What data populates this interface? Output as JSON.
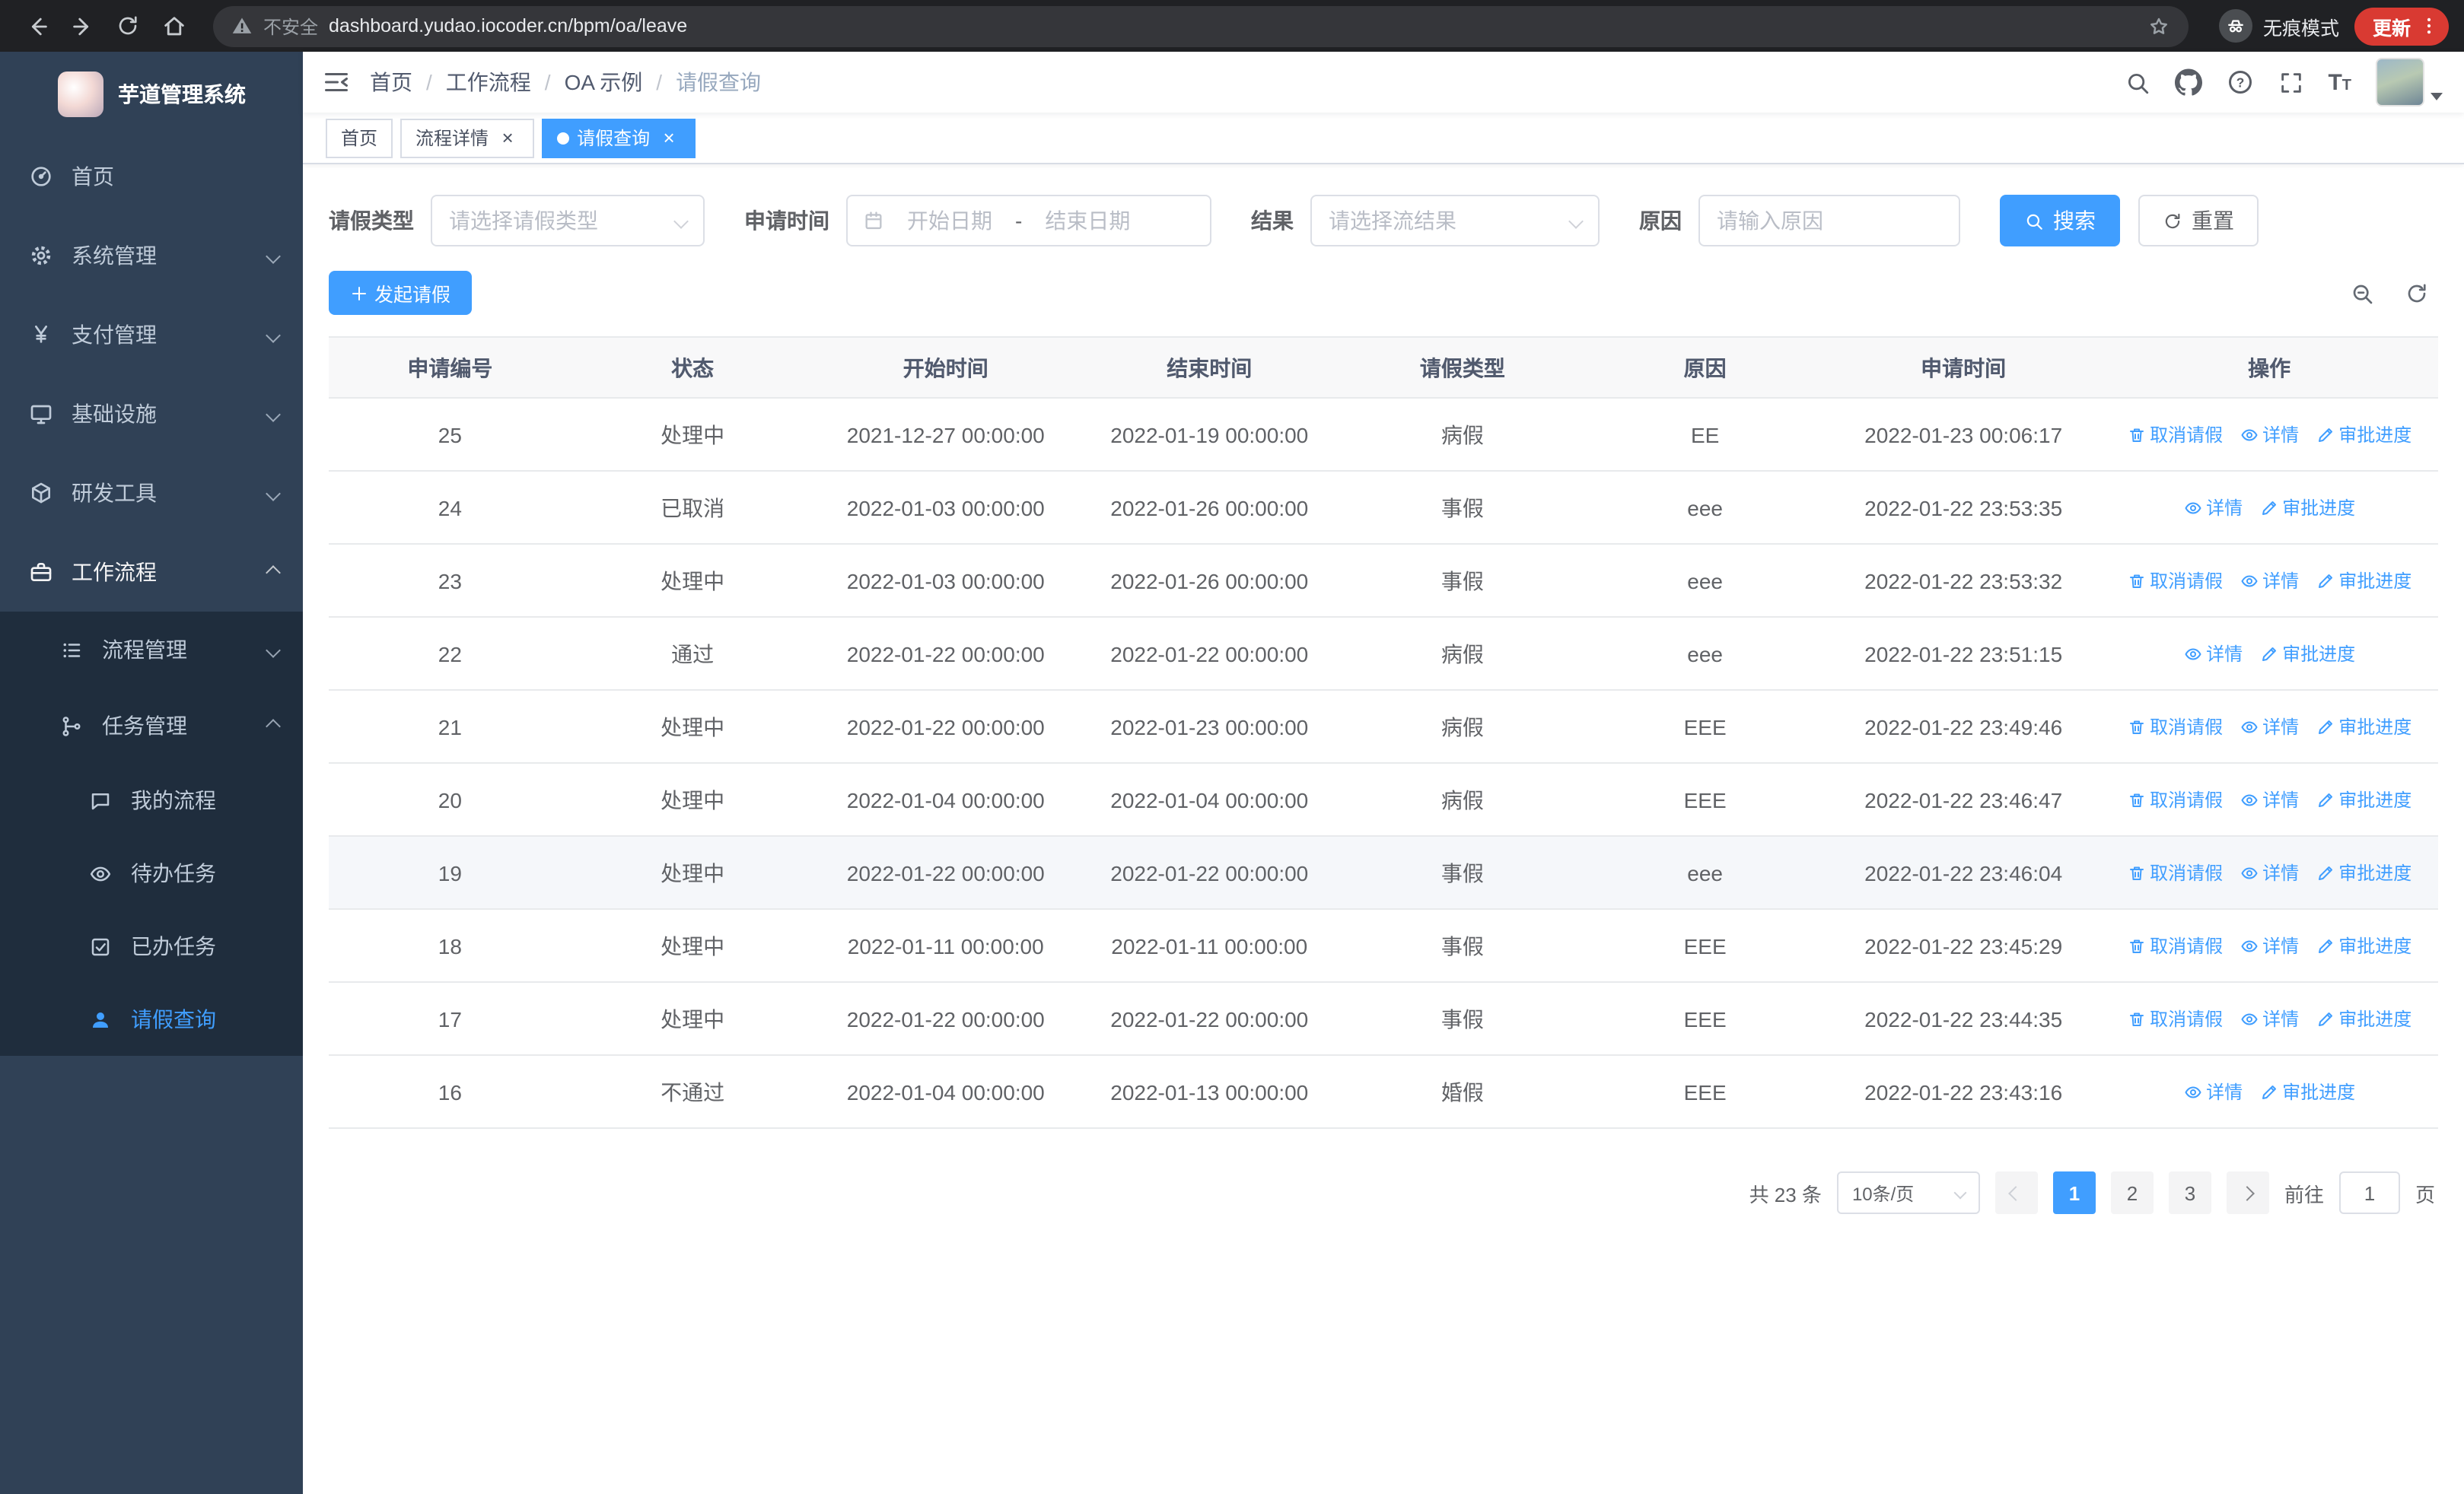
{
  "browser": {
    "security_label": "不安全",
    "url": "dashboard.yudao.iocoder.cn/bpm/oa/leave",
    "incognito_label": "无痕模式",
    "update_button": "更新"
  },
  "sidebar": {
    "app_title": "芋道管理系统",
    "items": [
      {
        "label": "首页"
      },
      {
        "label": "系统管理"
      },
      {
        "label": "支付管理"
      },
      {
        "label": "基础设施"
      },
      {
        "label": "研发工具"
      },
      {
        "label": "工作流程"
      }
    ],
    "sub_items": [
      {
        "label": "流程管理"
      },
      {
        "label": "任务管理"
      }
    ],
    "task_items": [
      {
        "label": "我的流程"
      },
      {
        "label": "待办任务"
      },
      {
        "label": "已办任务"
      },
      {
        "label": "请假查询"
      }
    ]
  },
  "header": {
    "breadcrumb": [
      "首页",
      "工作流程",
      "OA 示例",
      "请假查询"
    ]
  },
  "tabs": [
    {
      "label": "首页",
      "closable": false,
      "active": false
    },
    {
      "label": "流程详情",
      "closable": true,
      "active": false
    },
    {
      "label": "请假查询",
      "closable": true,
      "active": true
    }
  ],
  "filters": {
    "leave_type_label": "请假类型",
    "leave_type_placeholder": "请选择请假类型",
    "apply_time_label": "申请时间",
    "start_date_placeholder": "开始日期",
    "range_separator": "-",
    "end_date_placeholder": "结束日期",
    "result_label": "结果",
    "result_placeholder": "请选择流结果",
    "reason_label": "原因",
    "reason_placeholder": "请输入原因",
    "search_button": "搜索",
    "reset_button": "重置"
  },
  "toolbar": {
    "create_button": "发起请假"
  },
  "table": {
    "columns": [
      "申请编号",
      "状态",
      "开始时间",
      "结束时间",
      "请假类型",
      "原因",
      "申请时间",
      "操作"
    ],
    "actions": {
      "cancel": "取消请假",
      "detail": "详情",
      "progress": "审批进度"
    },
    "rows": [
      {
        "id": "25",
        "status": "处理中",
        "start": "2021-12-27 00:00:00",
        "end": "2022-01-19 00:00:00",
        "type": "病假",
        "reason": "EE",
        "applied": "2022-01-23 00:06:17",
        "cancellable": true,
        "highlighted": false
      },
      {
        "id": "24",
        "status": "已取消",
        "start": "2022-01-03 00:00:00",
        "end": "2022-01-26 00:00:00",
        "type": "事假",
        "reason": "eee",
        "applied": "2022-01-22 23:53:35",
        "cancellable": false,
        "highlighted": false
      },
      {
        "id": "23",
        "status": "处理中",
        "start": "2022-01-03 00:00:00",
        "end": "2022-01-26 00:00:00",
        "type": "事假",
        "reason": "eee",
        "applied": "2022-01-22 23:53:32",
        "cancellable": true,
        "highlighted": false
      },
      {
        "id": "22",
        "status": "通过",
        "start": "2022-01-22 00:00:00",
        "end": "2022-01-22 00:00:00",
        "type": "病假",
        "reason": "eee",
        "applied": "2022-01-22 23:51:15",
        "cancellable": false,
        "highlighted": false
      },
      {
        "id": "21",
        "status": "处理中",
        "start": "2022-01-22 00:00:00",
        "end": "2022-01-23 00:00:00",
        "type": "病假",
        "reason": "EEE",
        "applied": "2022-01-22 23:49:46",
        "cancellable": true,
        "highlighted": false
      },
      {
        "id": "20",
        "status": "处理中",
        "start": "2022-01-04 00:00:00",
        "end": "2022-01-04 00:00:00",
        "type": "病假",
        "reason": "EEE",
        "applied": "2022-01-22 23:46:47",
        "cancellable": true,
        "highlighted": false
      },
      {
        "id": "19",
        "status": "处理中",
        "start": "2022-01-22 00:00:00",
        "end": "2022-01-22 00:00:00",
        "type": "事假",
        "reason": "eee",
        "applied": "2022-01-22 23:46:04",
        "cancellable": true,
        "highlighted": true
      },
      {
        "id": "18",
        "status": "处理中",
        "start": "2022-01-11 00:00:00",
        "end": "2022-01-11 00:00:00",
        "type": "事假",
        "reason": "EEE",
        "applied": "2022-01-22 23:45:29",
        "cancellable": true,
        "highlighted": false
      },
      {
        "id": "17",
        "status": "处理中",
        "start": "2022-01-22 00:00:00",
        "end": "2022-01-22 00:00:00",
        "type": "事假",
        "reason": "EEE",
        "applied": "2022-01-22 23:44:35",
        "cancellable": true,
        "highlighted": false
      },
      {
        "id": "16",
        "status": "不通过",
        "start": "2022-01-04 00:00:00",
        "end": "2022-01-13 00:00:00",
        "type": "婚假",
        "reason": "EEE",
        "applied": "2022-01-22 23:43:16",
        "cancellable": false,
        "highlighted": false
      }
    ]
  },
  "pagination": {
    "total_label": "共 23 条",
    "page_size": "10条/页",
    "pages": [
      "1",
      "2",
      "3"
    ],
    "active_page": "1",
    "goto_label": "前往",
    "goto_value": "1",
    "page_unit": "页"
  },
  "colors": {
    "primary": "#409eff",
    "sidebar_bg": "#304156",
    "sidebar_submenu_bg": "#1f2d3d",
    "table_header_bg": "#f8f8f9",
    "update_chip": "#d93a32"
  }
}
